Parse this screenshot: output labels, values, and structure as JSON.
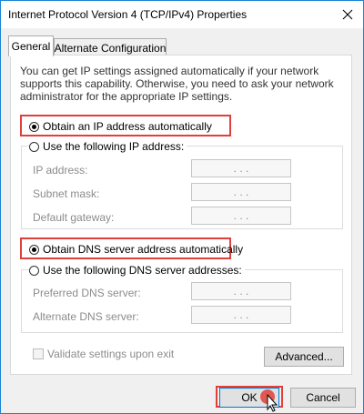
{
  "window": {
    "title": "Internet Protocol Version 4 (TCP/IPv4) Properties"
  },
  "tabs": [
    {
      "label": "General",
      "active": true
    },
    {
      "label": "Alternate Configuration",
      "active": false
    }
  ],
  "intro_text": "You can get IP settings assigned automatically if your network supports this capability. Otherwise, you need to ask your network administrator for the appropriate IP settings.",
  "ip_section": {
    "auto_option": {
      "label": "Obtain an IP address automatically",
      "selected": true
    },
    "manual_option": {
      "label": "Use the following IP address:",
      "selected": false
    },
    "fields": [
      {
        "label": "IP address:",
        "value": ". . ."
      },
      {
        "label": "Subnet mask:",
        "value": ". . ."
      },
      {
        "label": "Default gateway:",
        "value": ". . ."
      }
    ]
  },
  "dns_section": {
    "auto_option": {
      "label": "Obtain DNS server address automatically",
      "selected": true
    },
    "manual_option": {
      "label": "Use the following DNS server addresses:",
      "selected": false
    },
    "fields": [
      {
        "label": "Preferred DNS server:",
        "value": ". . ."
      },
      {
        "label": "Alternate DNS server:",
        "value": ". . ."
      }
    ]
  },
  "validate_checkbox": {
    "label": "Validate settings upon exit",
    "checked": false,
    "enabled": false
  },
  "buttons": {
    "advanced": "Advanced...",
    "ok": "OK",
    "cancel": "Cancel"
  },
  "colors": {
    "highlight": "#e0403a",
    "window_border": "#1883d7",
    "disabled_text": "#8c8c8c"
  }
}
